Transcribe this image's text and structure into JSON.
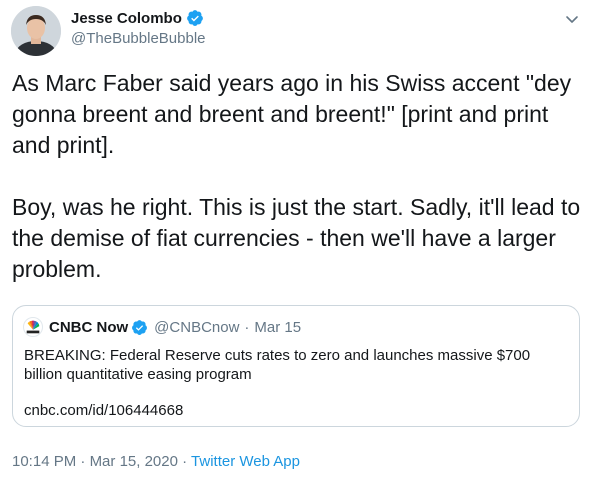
{
  "author": {
    "display_name": "Jesse Colombo",
    "handle": "@TheBubbleBubble",
    "avatar_icon": "person-avatar",
    "verified": true
  },
  "tweet": {
    "text": "As Marc Faber said years ago in his Swiss accent \"dey gonna breent and breent and breent!\" [print and print and print].\n\nBoy, was he right. This is just the start. Sadly, it'll lead to the demise of fiat currencies - then we'll have a larger problem."
  },
  "quoted_tweet": {
    "display_name": "CNBC Now",
    "handle": "@CNBCnow",
    "separator": "·",
    "date": "Mar 15",
    "text": "BREAKING: Federal Reserve cuts rates to zero and launches massive $700 billion quantitative easing program",
    "link": "cnbc.com/id/106444668",
    "avatar_icon": "nbc-peacock-logo",
    "verified": true
  },
  "meta": {
    "time": "10:14 PM",
    "separator": "·",
    "date": "Mar 15, 2020",
    "source": "Twitter Web App"
  },
  "colors": {
    "text": "#14171a",
    "secondary": "#657786",
    "verified_blue": "#1da1f2",
    "link": "#1b95e0",
    "border": "#ccd6dd"
  }
}
